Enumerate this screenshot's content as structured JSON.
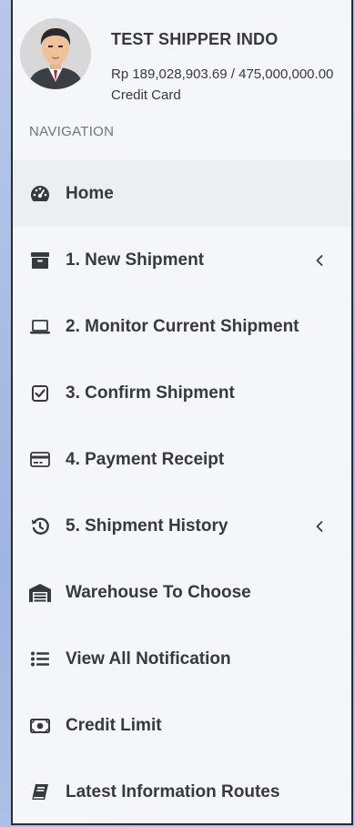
{
  "user": {
    "name": "TEST SHIPPER INDO",
    "credit": "Rp 189,028,903.69 / 475,000,000.00",
    "payment_method": "Credit Card"
  },
  "navigation": {
    "header": "NAVIGATION",
    "items": [
      {
        "label": "Home",
        "icon": "dashboard-icon",
        "active": true,
        "has_children": false
      },
      {
        "label": "1. New Shipment",
        "icon": "archive-box-icon",
        "active": false,
        "has_children": true
      },
      {
        "label": "2. Monitor Current Shipment",
        "icon": "laptop-icon",
        "active": false,
        "has_children": false
      },
      {
        "label": "3. Confirm Shipment",
        "icon": "checkbox-icon",
        "active": false,
        "has_children": false
      },
      {
        "label": "4. Payment Receipt",
        "icon": "credit-card-icon",
        "active": false,
        "has_children": false
      },
      {
        "label": "5. Shipment History",
        "icon": "history-icon",
        "active": false,
        "has_children": true
      },
      {
        "label": "Warehouse To Choose",
        "icon": "warehouse-icon",
        "active": false,
        "has_children": false
      },
      {
        "label": "View All Notification",
        "icon": "list-icon",
        "active": false,
        "has_children": false
      },
      {
        "label": "Credit Limit",
        "icon": "money-bill-icon",
        "active": false,
        "has_children": false
      },
      {
        "label": "Latest Information Routes",
        "icon": "book-icon",
        "active": false,
        "has_children": false
      }
    ]
  },
  "colors": {
    "sidebar_bg": "#f4f6f9",
    "active_bg": "#eceef1",
    "text": "#343a40",
    "muted": "#6c757d",
    "page_bg": "#a9bde3"
  }
}
